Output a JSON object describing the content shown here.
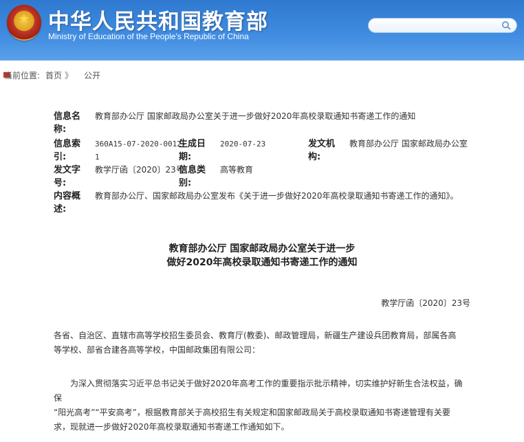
{
  "header": {
    "title_cn": "中华人民共和国教育部",
    "title_en": "Ministry of Education of the People's Republic of China",
    "search_placeholder": "",
    "emblem_icon": "national-emblem",
    "accent_color": "#3f8be0"
  },
  "breadcrumb": {
    "label": "当前位置:",
    "home": "首页",
    "sep1": "》",
    "current": "公开",
    "sep2": "》"
  },
  "meta": {
    "name_label": "信息名称:",
    "name_value": "教育部办公厅 国家邮政局办公室关于进一步做好2020年高校录取通知书寄递工作的通知",
    "index_label": "信息索引:",
    "index_value_1": "360A15-07-2020-0012-",
    "index_value_2": "1",
    "date_label": "生成日期:",
    "date_value": "2020-07-23",
    "issuer_label": "发文机构:",
    "issuer_value": "教育部办公厅 国家邮政局办公室",
    "docno_label": "发文字号:",
    "docno_value": "教学厅函〔2020〕23号",
    "category_label": "信息类别:",
    "category_value": "高等教育",
    "summary_label": "内容概述:",
    "summary_value": "教育部办公厅、国家邮政局办公室发布《关于进一步做好2020年高校录取通知书寄递工作的通知》。"
  },
  "document": {
    "title_line1": "教育部办公厅 国家邮政局办公室关于进一步",
    "title_line2": "做好2020年高校录取通知书寄递工作的通知",
    "doc_number": "教学厅函〔2020〕23号",
    "para1_line1": "各省、自治区、直辖市高等学校招生委员会、教育厅(教委)、邮政管理局，新疆生产建设兵团教育局，部属各高",
    "para1_line2": "等学校、部省合建各高等学校，中国邮政集团有限公司：",
    "para2_line1": "为深入贯彻落实习近平总书记关于做好2020年高考工作的重要指示批示精神，切实维护好新生合法权益，确保",
    "para2_line2": "“阳光高考”“平安高考”，根据教育部关于高校招生有关规定和国家邮政局关于高校录取通知书寄递管理有关要",
    "para2_line3": "求，现就进一步做好2020年高校录取通知书寄递工作通知如下。"
  }
}
